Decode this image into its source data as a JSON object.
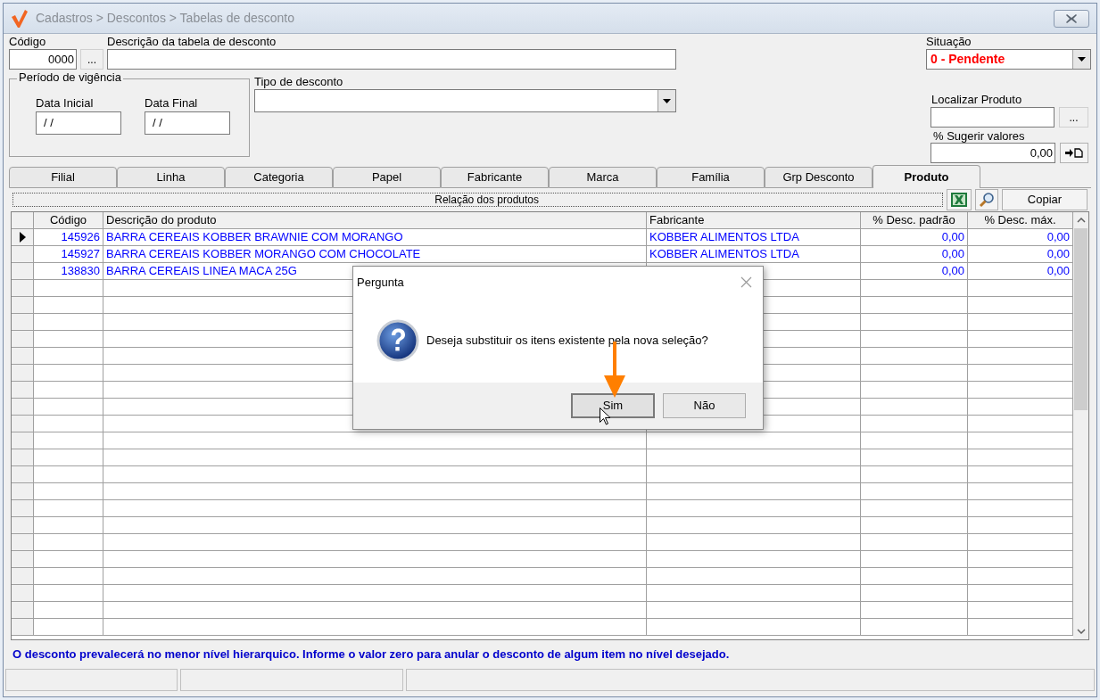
{
  "window": {
    "title": "Cadastros > Descontos > Tabelas de desconto"
  },
  "form": {
    "codigo": {
      "label": "Código",
      "value": "0000"
    },
    "codigo_button": "...",
    "descricao": {
      "label": "Descrição da tabela de desconto"
    },
    "situacao": {
      "label": "Situação",
      "value": "0 - Pendente"
    },
    "periodo": {
      "title": "Período de vigência",
      "data_inicial": {
        "label": "Data Inicial",
        "value": "/ /"
      },
      "data_final": {
        "label": "Data Final",
        "value": "/ /"
      }
    },
    "tipo": {
      "label": "Tipo de desconto"
    },
    "localizar": {
      "label": "Localizar Produto",
      "button": "..."
    },
    "sugerir": {
      "label": "% Sugerir valores",
      "value": "0,00"
    }
  },
  "tabs": [
    {
      "label": "Filial",
      "selected": false
    },
    {
      "label": "Linha",
      "selected": false
    },
    {
      "label": "Categoria",
      "selected": false
    },
    {
      "label": "Papel",
      "selected": false
    },
    {
      "label": "Fabricante",
      "selected": false
    },
    {
      "label": "Marca",
      "selected": false
    },
    {
      "label": "Família",
      "selected": false
    },
    {
      "label": "Grp Desconto",
      "selected": false
    },
    {
      "label": "Produto",
      "selected": true
    }
  ],
  "toolbar": {
    "caption": "Relação dos produtos",
    "copy_button": "Copiar"
  },
  "table": {
    "columns": [
      "Código",
      "Descrição do produto",
      "Fabricante",
      "% Desc. padrão",
      "% Desc. máx."
    ],
    "rows": [
      {
        "selected": true,
        "cells": [
          "145926",
          "BARRA CEREAIS KOBBER BRAWNIE COM MORANGO",
          "KOBBER ALIMENTOS LTDA",
          "0,00",
          "0,00"
        ]
      },
      {
        "selected": false,
        "cells": [
          "145927",
          "BARRA CEREAIS KOBBER MORANGO COM CHOCOLATE",
          "KOBBER ALIMENTOS LTDA",
          "0,00",
          "0,00"
        ]
      },
      {
        "selected": false,
        "cells": [
          "138830",
          "BARRA CEREAIS LINEA MACA 25G",
          null,
          "0,00",
          "0,00"
        ]
      }
    ]
  },
  "dialog": {
    "title": "Pergunta",
    "message": "Deseja substituir os itens existente pela nova seleção?",
    "buttons": [
      {
        "label": "Sim",
        "focused": true
      },
      {
        "label": "Não",
        "focused": false
      }
    ]
  },
  "footer_message": "O desconto prevalecerá no menor nível hierarquico. Informe o valor zero para anular o desconto de algum item no nível desejado."
}
